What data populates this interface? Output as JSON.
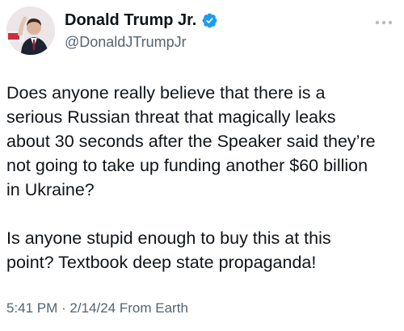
{
  "author": {
    "display_name": "Donald Trump Jr.",
    "handle": "@DonaldJTrumpJr",
    "verified": true,
    "avatar": "profile-photo"
  },
  "menu": {
    "icon": "more-horizontal-icon"
  },
  "tweet": {
    "paragraphs": [
      "Does anyone really believe that there is a\nserious Russian threat that magically leaks\nabout 30 seconds after the Speaker said they’re\nnot going to take up funding another $60 billion\nin Ukraine?",
      "Is anyone stupid enough to buy this at this\npoint? Textbook deep state propaganda!"
    ]
  },
  "meta": {
    "time": "5:41 PM",
    "separator": " · ",
    "date": "2/14/24",
    "source": " From Earth"
  },
  "colors": {
    "text": "#0f1419",
    "muted": "#536471",
    "verified_blue": "#1d9bf0"
  }
}
